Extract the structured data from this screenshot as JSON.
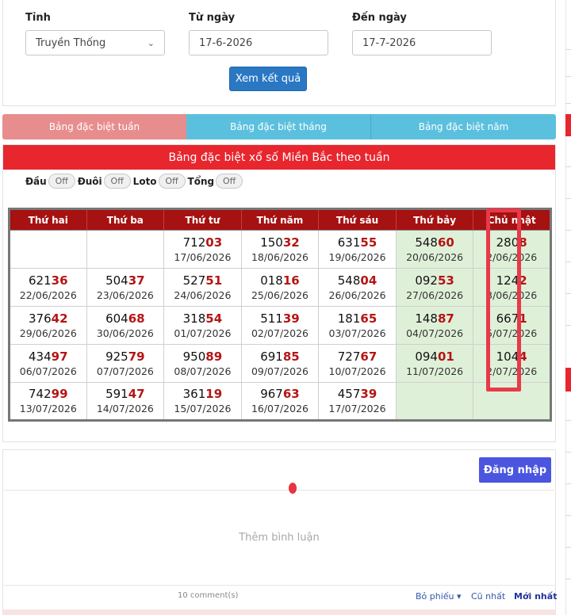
{
  "filters": {
    "province_label": "Tỉnh",
    "province_value": "Truyền Thống",
    "from_label": "Từ ngày",
    "from_value": "17-6-2026",
    "to_label": "Đến ngày",
    "to_value": "17-7-2026",
    "view_button": "Xem kết quả"
  },
  "tabs": [
    {
      "label": "Bảng đặc biệt tuần",
      "active": true
    },
    {
      "label": "Bảng đặc biệt tháng",
      "active": false
    },
    {
      "label": "Bảng đặc biệt năm",
      "active": false
    }
  ],
  "results": {
    "title": "Bảng đặc biệt xổ số Miền Bắc theo tuần",
    "toggles": [
      {
        "label": "Đầu",
        "state": "Off"
      },
      {
        "label": "Đuôi",
        "state": "Off"
      },
      {
        "label": "Loto",
        "state": "Off"
      },
      {
        "label": "Tổng",
        "state": "Off"
      }
    ],
    "days": [
      "Thứ hai",
      "Thứ ba",
      "Thứ tư",
      "Thứ năm",
      "Thứ sáu",
      "Thứ bảy",
      "Chủ nhật"
    ],
    "weeks": [
      [
        null,
        null,
        {
          "head": "712",
          "tail": "03",
          "date": "17/06/2026"
        },
        {
          "head": "150",
          "tail": "32",
          "date": "18/06/2026"
        },
        {
          "head": "631",
          "tail": "55",
          "date": "19/06/2026"
        },
        {
          "head": "548",
          "tail": "60",
          "date": "20/06/2026"
        },
        {
          "head": "280",
          "tail": "8",
          "date": "2/06/2026"
        }
      ],
      [
        {
          "head": "621",
          "tail": "36",
          "date": "22/06/2026"
        },
        {
          "head": "504",
          "tail": "37",
          "date": "23/06/2026"
        },
        {
          "head": "527",
          "tail": "51",
          "date": "24/06/2026"
        },
        {
          "head": "018",
          "tail": "16",
          "date": "25/06/2026"
        },
        {
          "head": "548",
          "tail": "04",
          "date": "26/06/2026"
        },
        {
          "head": "092",
          "tail": "53",
          "date": "27/06/2026"
        },
        {
          "head": "124",
          "tail": "2",
          "date": "3/06/2026"
        }
      ],
      [
        {
          "head": "376",
          "tail": "42",
          "date": "29/06/2026"
        },
        {
          "head": "604",
          "tail": "68",
          "date": "30/06/2026"
        },
        {
          "head": "318",
          "tail": "54",
          "date": "01/07/2026"
        },
        {
          "head": "511",
          "tail": "39",
          "date": "02/07/2026"
        },
        {
          "head": "181",
          "tail": "65",
          "date": "03/07/2026"
        },
        {
          "head": "148",
          "tail": "87",
          "date": "04/07/2026"
        },
        {
          "head": "667",
          "tail": "1",
          "date": "5/07/2026"
        }
      ],
      [
        {
          "head": "434",
          "tail": "97",
          "date": "06/07/2026"
        },
        {
          "head": "925",
          "tail": "79",
          "date": "07/07/2026"
        },
        {
          "head": "950",
          "tail": "89",
          "date": "08/07/2026"
        },
        {
          "head": "691",
          "tail": "85",
          "date": "09/07/2026"
        },
        {
          "head": "727",
          "tail": "67",
          "date": "10/07/2026"
        },
        {
          "head": "094",
          "tail": "01",
          "date": "11/07/2026"
        },
        {
          "head": "104",
          "tail": "4",
          "date": "2/07/2026"
        }
      ],
      [
        {
          "head": "742",
          "tail": "99",
          "date": "13/07/2026"
        },
        {
          "head": "591",
          "tail": "47",
          "date": "14/07/2026"
        },
        {
          "head": "361",
          "tail": "19",
          "date": "15/07/2026"
        },
        {
          "head": "967",
          "tail": "63",
          "date": "16/07/2026"
        },
        {
          "head": "457",
          "tail": "39",
          "date": "17/07/2026"
        },
        null,
        null
      ]
    ]
  },
  "comments": {
    "login_button": "Đăng nhập",
    "placeholder": "Thêm bình luận",
    "count": "10 comment(s)",
    "sort_vote": "Bỏ phiếu ▾",
    "sort_old": "Cũ nhất",
    "sort_new": "Mới nhất"
  },
  "colors": {
    "header_red": "#e8262e",
    "table_head": "#a61111",
    "tail_red": "#b51515",
    "weekend_green": "#dff0d8",
    "tab_active": "#e88d8d",
    "tab_inactive": "#5bc0de",
    "view_button": "#2a78c4",
    "login_button": "#4a55e0"
  }
}
